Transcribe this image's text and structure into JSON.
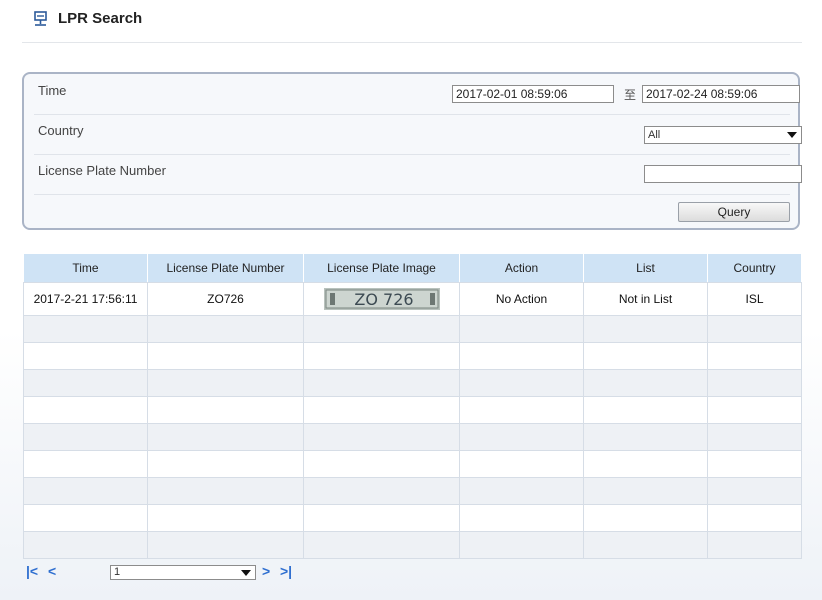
{
  "header": {
    "title": "LPR Search",
    "icon": "lpr-search-icon"
  },
  "search": {
    "time_label": "Time",
    "time_start": "2017-02-01 08:59:06",
    "time_separator": "至",
    "time_end": "2017-02-24 08:59:06",
    "country_label": "Country",
    "country_value": "All",
    "plate_label": "License Plate Number",
    "plate_value": "",
    "query_label": "Query"
  },
  "table": {
    "columns": [
      "Time",
      "License Plate Number",
      "License Plate Image",
      "Action",
      "List",
      "Country"
    ],
    "rows": [
      {
        "time": "2017-2-21 17:56:11",
        "plate": "ZO726",
        "image_text": "ZO 726",
        "action": "No Action",
        "list": "Not in List",
        "country": "ISL"
      }
    ],
    "empty_rows": 9
  },
  "pagination": {
    "current_page": "1"
  },
  "colors": {
    "header_bg": "#cfe3f5",
    "accent": "#2f6fd0",
    "panel_border": "#aab4c6"
  }
}
